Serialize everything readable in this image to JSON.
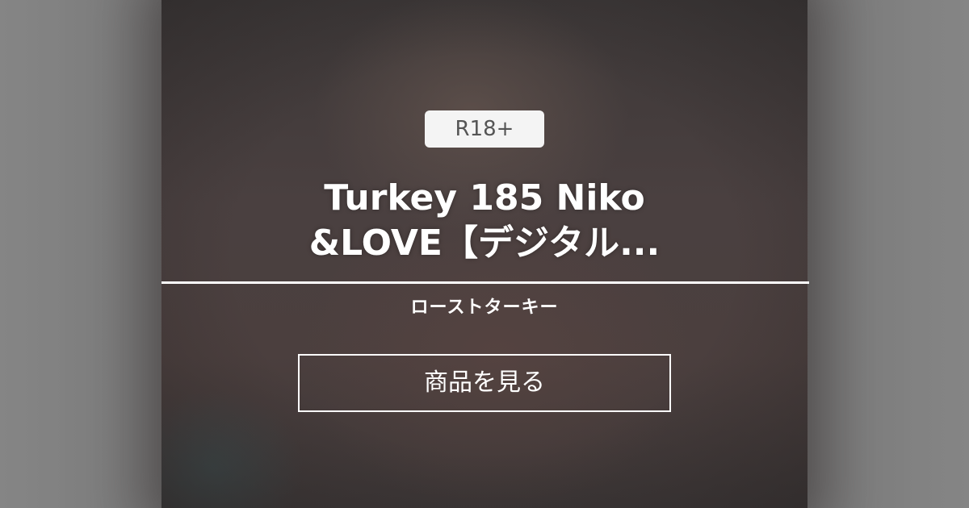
{
  "badge": {
    "label": "R18+"
  },
  "product": {
    "title_line1": "Turkey 185 Niko",
    "title_line2": "&LOVE【デジタル..."
  },
  "creator": {
    "name": "ローストターキー"
  },
  "actions": {
    "view_product_label": "商品を見る"
  }
}
